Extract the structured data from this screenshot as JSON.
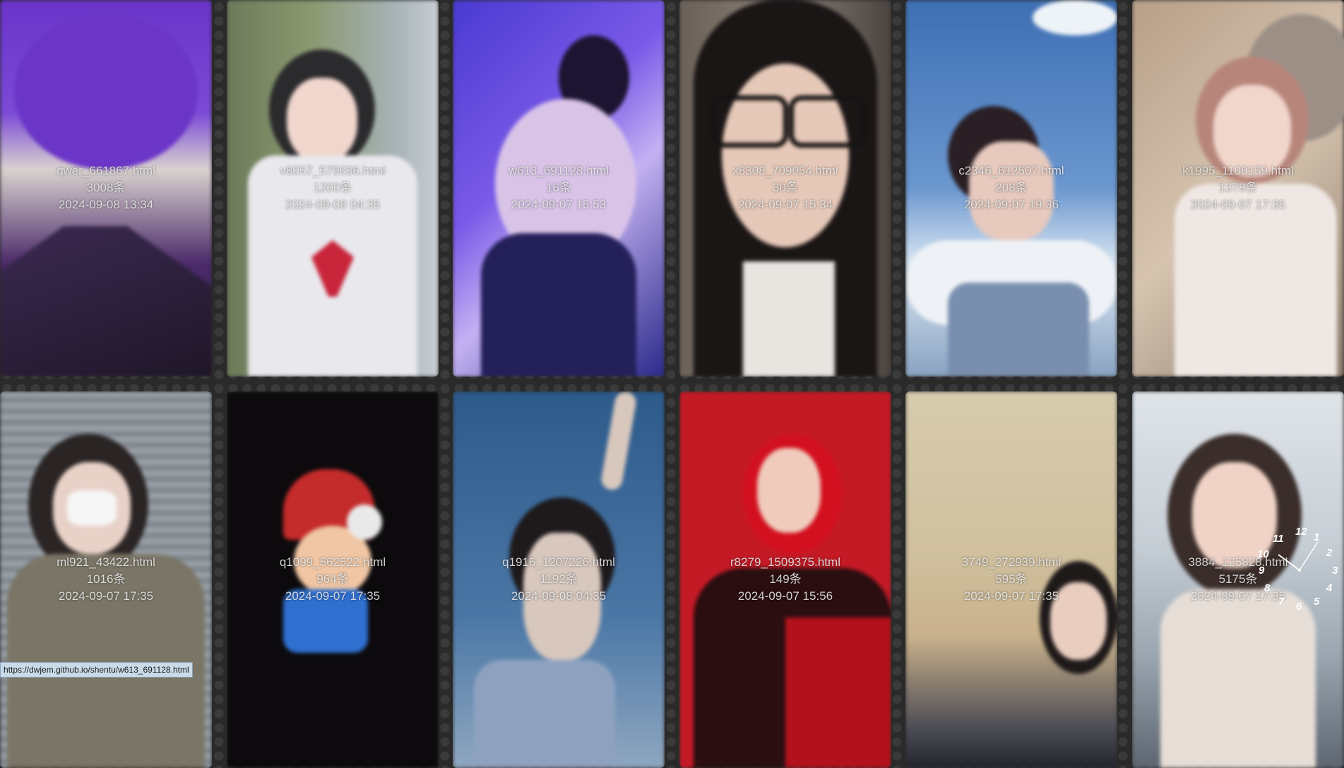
{
  "cards": [
    {
      "filename": "qwer_661867.html",
      "count": "3008条",
      "date": "2024-09-08 13:34"
    },
    {
      "filename": "v8057_579036.html",
      "count": "1200条",
      "date": "2024-09-08 04:35"
    },
    {
      "filename": "w613_691128.html",
      "count": "16条",
      "date": "2024-09-07 15:53"
    },
    {
      "filename": "x8308_709054.html",
      "count": "30条",
      "date": "2024-09-07 15:34"
    },
    {
      "filename": "c2346_612507.html",
      "count": "208条",
      "date": "2024-09-07 19:36"
    },
    {
      "filename": "k1995_1100159.html",
      "count": "1378条",
      "date": "2024-09-07 17:35"
    },
    {
      "filename": "ml921_43422.html",
      "count": "1016条",
      "date": "2024-09-07 17:35"
    },
    {
      "filename": "q1099_562522.html",
      "count": "964条",
      "date": "2024-09-07 17:35"
    },
    {
      "filename": "q1916_1207226.html",
      "count": "1192条",
      "date": "2024-09-08 04:35"
    },
    {
      "filename": "r8279_1509375.html",
      "count": "149条",
      "date": "2024-09-07 15:56"
    },
    {
      "filename": "3749_272939.html",
      "count": "595条",
      "date": "2024-09-07 17:35"
    },
    {
      "filename": "3884_125828.html",
      "count": "5175条",
      "date": "2024-09-07 17:35"
    }
  ],
  "status_url": "https://dwjem.github.io/shentu/w613_691128.html",
  "clock_numbers": [
    "12",
    "1",
    "2",
    "3",
    "4",
    "5",
    "6",
    "7",
    "8",
    "9",
    "10",
    "11"
  ]
}
